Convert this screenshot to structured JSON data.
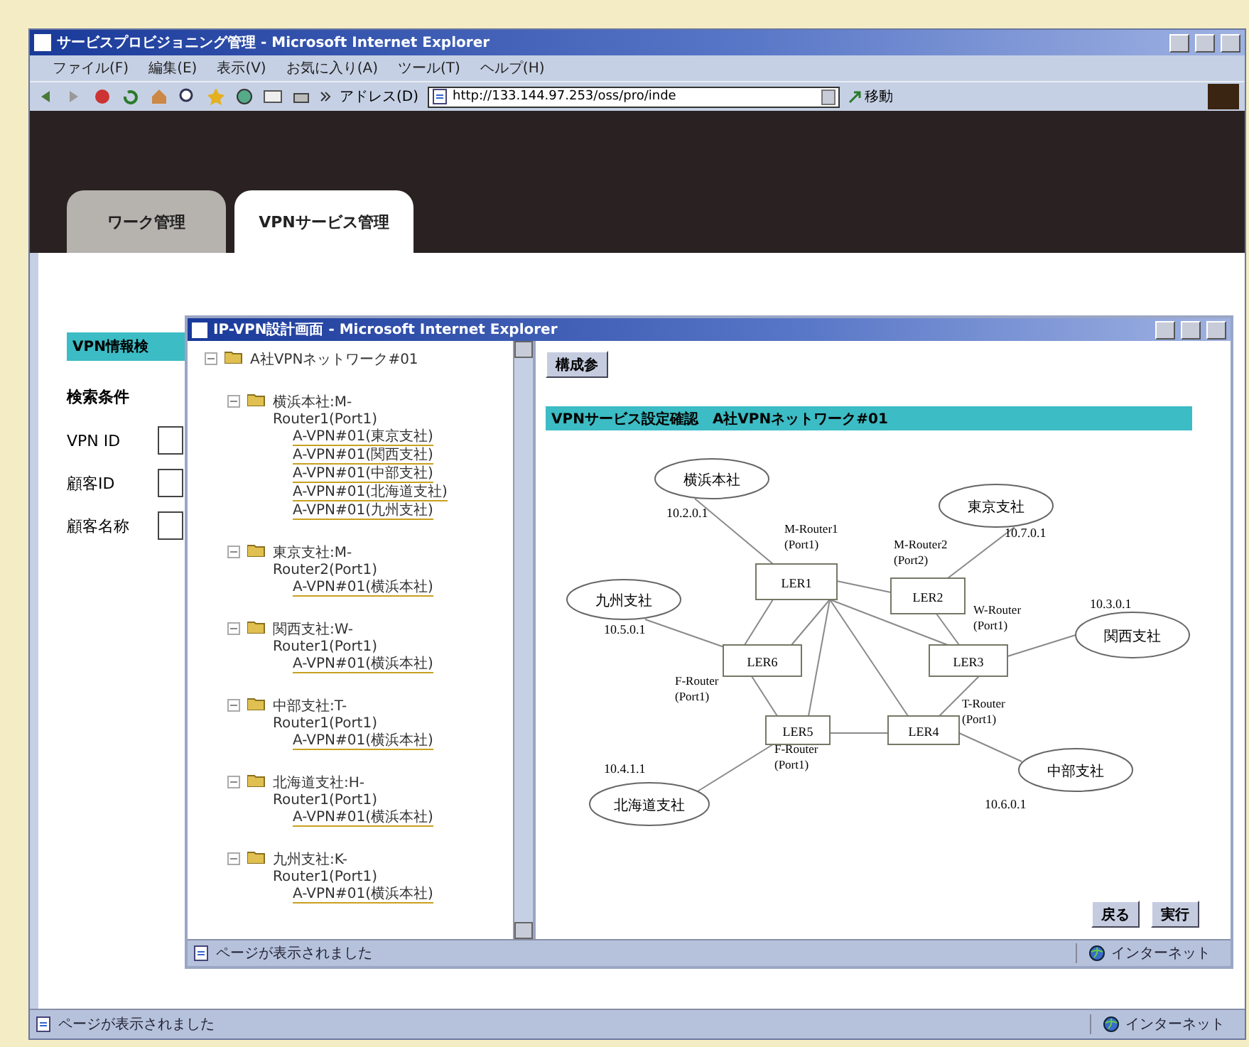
{
  "browser": {
    "title": "サービスプロビジョニング管理 - Microsoft Internet Explorer",
    "menu": [
      "ファイル(F)",
      "編集(E)",
      "表示(V)",
      "お気に入り(A)",
      "ツール(T)",
      "ヘルプ(H)"
    ],
    "address_label": "アドレス(D)",
    "url": "http://133.144.97.253/oss/pro/inde",
    "go": "移動",
    "status": "ページが表示されました",
    "zone": "インターネット"
  },
  "tabs": [
    {
      "label": "ワーク管理",
      "selected": false
    },
    {
      "label": "VPNサービス管理",
      "selected": true
    }
  ],
  "search_panel": {
    "heading": "VPN情報検",
    "section": "検索条件",
    "fields": [
      {
        "label": "VPN ID"
      },
      {
        "label": "顧客ID"
      },
      {
        "label": "顧客名称"
      }
    ]
  },
  "popup": {
    "title": "IP-VPN設計画面 - Microsoft Internet Explorer",
    "tree": {
      "label": "A社VPNネットワーク#01",
      "expanded": true,
      "children": [
        {
          "label": "横浜本社:M-Router1(Port1)",
          "expanded": true,
          "children": [
            {
              "label": "A-VPN#01(東京支社)"
            },
            {
              "label": "A-VPN#01(関西支社)"
            },
            {
              "label": "A-VPN#01(中部支社)"
            },
            {
              "label": "A-VPN#01(北海道支社)"
            },
            {
              "label": "A-VPN#01(九州支社)"
            }
          ]
        },
        {
          "label": "東京支社:M-Router2(Port1)",
          "expanded": true,
          "children": [
            {
              "label": "A-VPN#01(横浜本社)"
            }
          ]
        },
        {
          "label": "関西支社:W-Router1(Port1)",
          "expanded": true,
          "children": [
            {
              "label": "A-VPN#01(横浜本社)"
            }
          ]
        },
        {
          "label": "中部支社:T-Router1(Port1)",
          "expanded": true,
          "children": [
            {
              "label": "A-VPN#01(横浜本社)"
            }
          ]
        },
        {
          "label": "北海道支社:H-Router1(Port1)",
          "expanded": true,
          "children": [
            {
              "label": "A-VPN#01(横浜本社)"
            }
          ]
        },
        {
          "label": "九州支社:K-Router1(Port1)",
          "expanded": true,
          "children": [
            {
              "label": "A-VPN#01(横浜本社)"
            }
          ]
        }
      ]
    },
    "button": "構成参",
    "heading": "VPNサービス設定確認　A社VPNネットワーク#01",
    "diagram": {
      "sites": [
        {
          "label": "横浜本社",
          "ip": "10.2.0.1"
        },
        {
          "label": "東京支社",
          "ip": "10.7.0.1"
        },
        {
          "label": "九州支社",
          "ip": "10.5.0.1"
        },
        {
          "label": "関西支社",
          "ip": "10.3.0.1"
        },
        {
          "label": "北海道支社",
          "ip": "10.4.1.1"
        },
        {
          "label": "中部支社",
          "ip": "10.6.0.1"
        }
      ],
      "routers": [
        {
          "label": "LER1"
        },
        {
          "label": "LER2"
        },
        {
          "label": "LER6"
        },
        {
          "label": "LER3"
        },
        {
          "label": "LER5"
        },
        {
          "label": "LER4"
        }
      ],
      "ports": [
        {
          "router": "M-Router1",
          "port": "(Port1)"
        },
        {
          "router": "M-Router2",
          "port": "(Port2)"
        },
        {
          "router": "W-Router",
          "port": "(Port1)"
        },
        {
          "router": "F-Router",
          "port": "(Port1)"
        },
        {
          "router": "T-Router",
          "port": "(Port1)"
        },
        {
          "router": "F-Router",
          "port": "(Port1)"
        }
      ]
    },
    "buttons": [
      "戻る",
      "実行"
    ],
    "status": "ページが表示されました",
    "zone": "インターネット"
  }
}
